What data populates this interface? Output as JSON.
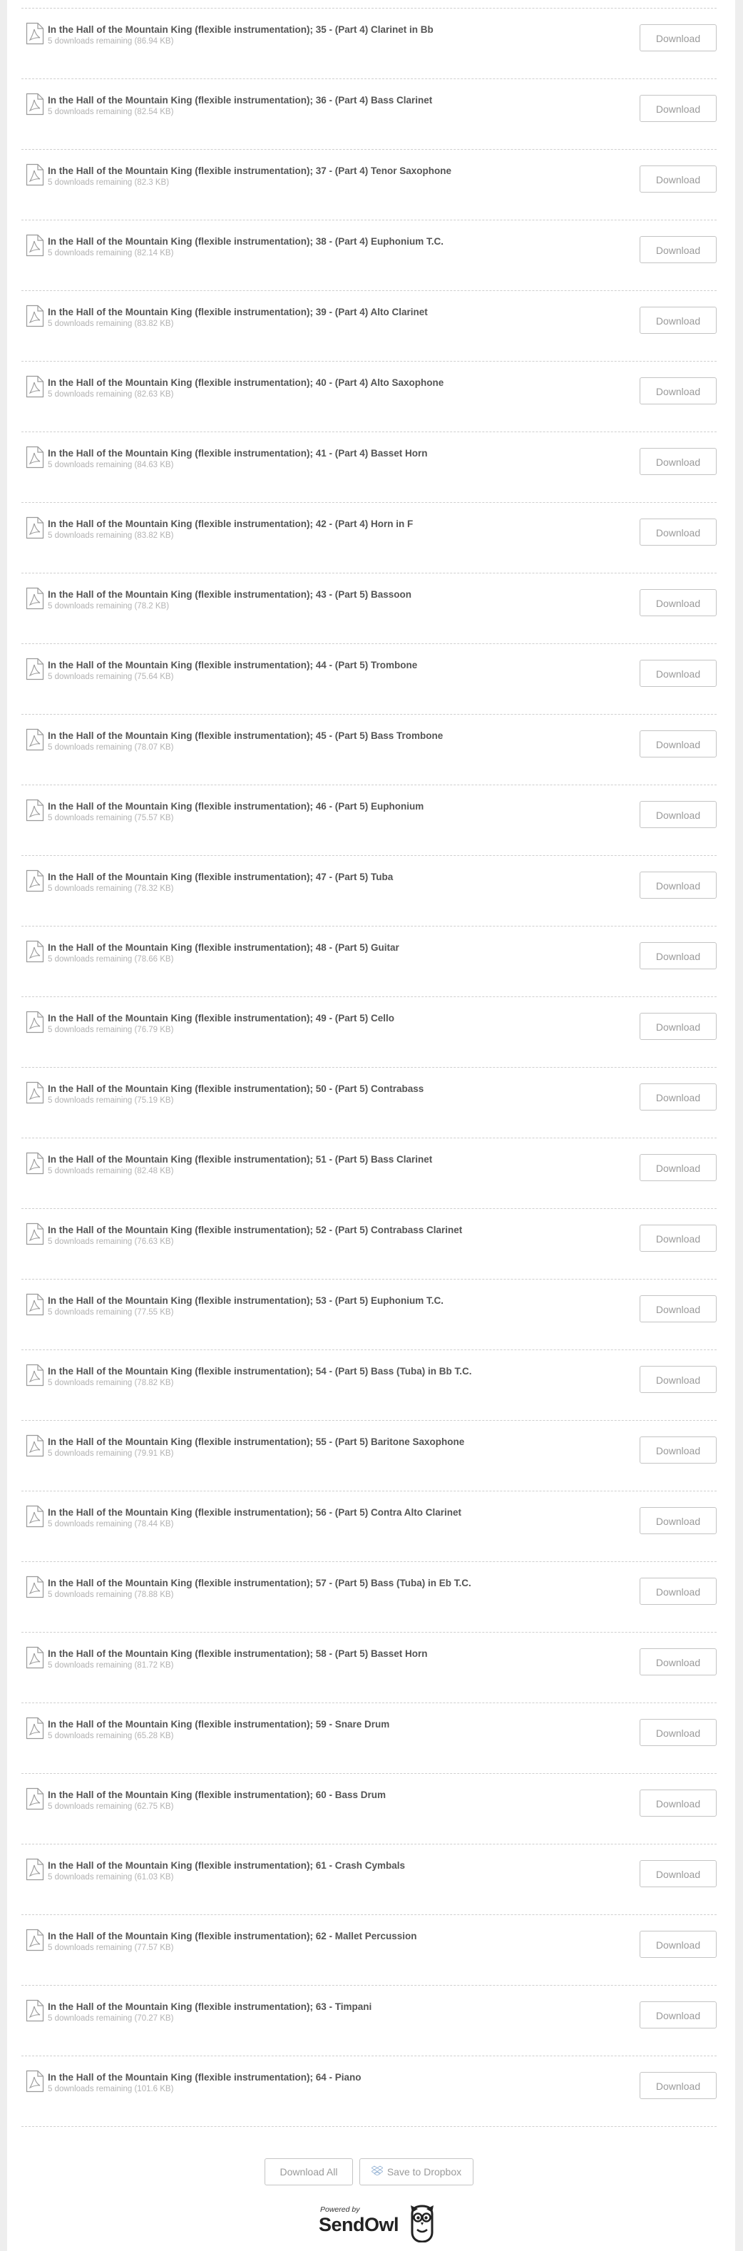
{
  "rows": [
    {
      "title": "In the Hall of the Mountain King (flexible instrumentation); 35 - (Part 4) Clarinet in Bb",
      "meta": "5 downloads remaining (86.94 KB)",
      "button": "Download"
    },
    {
      "title": "In the Hall of the Mountain King (flexible instrumentation); 36 - (Part 4) Bass Clarinet",
      "meta": "5 downloads remaining (82.54 KB)",
      "button": "Download"
    },
    {
      "title": "In the Hall of the Mountain King (flexible instrumentation); 37 - (Part 4) Tenor Saxophone",
      "meta": "5 downloads remaining (82.3 KB)",
      "button": "Download"
    },
    {
      "title": "In the Hall of the Mountain King (flexible instrumentation); 38 - (Part 4) Euphonium T.C.",
      "meta": "5 downloads remaining (82.14 KB)",
      "button": "Download"
    },
    {
      "title": "In the Hall of the Mountain King (flexible instrumentation); 39 - (Part 4) Alto Clarinet",
      "meta": "5 downloads remaining (83.82 KB)",
      "button": "Download"
    },
    {
      "title": "In the Hall of the Mountain King (flexible instrumentation); 40 - (Part 4) Alto Saxophone",
      "meta": "5 downloads remaining (82.63 KB)",
      "button": "Download"
    },
    {
      "title": "In the Hall of the Mountain King (flexible instrumentation); 41 - (Part 4) Basset Horn",
      "meta": "5 downloads remaining (84.63 KB)",
      "button": "Download"
    },
    {
      "title": "In the Hall of the Mountain King (flexible instrumentation); 42 - (Part 4) Horn in F",
      "meta": "5 downloads remaining (83.82 KB)",
      "button": "Download"
    },
    {
      "title": "In the Hall of the Mountain King (flexible instrumentation); 43 - (Part 5) Bassoon",
      "meta": "5 downloads remaining (78.2 KB)",
      "button": "Download"
    },
    {
      "title": "In the Hall of the Mountain King (flexible instrumentation); 44 - (Part 5) Trombone",
      "meta": "5 downloads remaining (75.64 KB)",
      "button": "Download"
    },
    {
      "title": "In the Hall of the Mountain King (flexible instrumentation); 45 - (Part 5) Bass Trombone",
      "meta": "5 downloads remaining (78.07 KB)",
      "button": "Download"
    },
    {
      "title": "In the Hall of the Mountain King (flexible instrumentation); 46 - (Part 5) Euphonium",
      "meta": "5 downloads remaining (75.57 KB)",
      "button": "Download"
    },
    {
      "title": "In the Hall of the Mountain King (flexible instrumentation); 47 - (Part 5) Tuba",
      "meta": "5 downloads remaining (78.32 KB)",
      "button": "Download"
    },
    {
      "title": "In the Hall of the Mountain King (flexible instrumentation); 48 - (Part 5) Guitar",
      "meta": "5 downloads remaining (78.66 KB)",
      "button": "Download"
    },
    {
      "title": "In the Hall of the Mountain King (flexible instrumentation); 49 - (Part 5) Cello",
      "meta": "5 downloads remaining (76.79 KB)",
      "button": "Download"
    },
    {
      "title": "In the Hall of the Mountain King (flexible instrumentation); 50 - (Part 5) Contrabass",
      "meta": "5 downloads remaining (75.19 KB)",
      "button": "Download"
    },
    {
      "title": "In the Hall of the Mountain King (flexible instrumentation); 51 - (Part 5) Bass Clarinet",
      "meta": "5 downloads remaining (82.48 KB)",
      "button": "Download"
    },
    {
      "title": "In the Hall of the Mountain King (flexible instrumentation); 52 - (Part 5) Contrabass Clarinet",
      "meta": "5 downloads remaining (76.63 KB)",
      "button": "Download"
    },
    {
      "title": "In the Hall of the Mountain King (flexible instrumentation); 53 - (Part 5) Euphonium T.C.",
      "meta": "5 downloads remaining (77.55 KB)",
      "button": "Download"
    },
    {
      "title": "In the Hall of the Mountain King (flexible instrumentation); 54 - (Part 5) Bass (Tuba) in Bb T.C.",
      "meta": "5 downloads remaining (78.82 KB)",
      "button": "Download"
    },
    {
      "title": "In the Hall of the Mountain King (flexible instrumentation); 55 - (Part 5) Baritone Saxophone",
      "meta": "5 downloads remaining (79.91 KB)",
      "button": "Download"
    },
    {
      "title": "In the Hall of the Mountain King (flexible instrumentation); 56 - (Part 5) Contra Alto Clarinet",
      "meta": "5 downloads remaining (78.44 KB)",
      "button": "Download"
    },
    {
      "title": "In the Hall of the Mountain King (flexible instrumentation); 57 - (Part 5) Bass (Tuba) in Eb T.C.",
      "meta": "5 downloads remaining (78.88 KB)",
      "button": "Download"
    },
    {
      "title": "In the Hall of the Mountain King (flexible instrumentation); 58 - (Part 5) Basset Horn",
      "meta": "5 downloads remaining (81.72 KB)",
      "button": "Download"
    },
    {
      "title": "In the Hall of the Mountain King (flexible instrumentation); 59 - Snare Drum",
      "meta": "5 downloads remaining (65.28 KB)",
      "button": "Download"
    },
    {
      "title": "In the Hall of the Mountain King (flexible instrumentation); 60 - Bass Drum",
      "meta": "5 downloads remaining (62.75 KB)",
      "button": "Download"
    },
    {
      "title": "In the Hall of the Mountain King (flexible instrumentation); 61 - Crash Cymbals",
      "meta": "5 downloads remaining (61.03 KB)",
      "button": "Download"
    },
    {
      "title": "In the Hall of the Mountain King (flexible instrumentation); 62 - Mallet Percussion",
      "meta": "5 downloads remaining (77.57 KB)",
      "button": "Download"
    },
    {
      "title": "In the Hall of the Mountain King (flexible instrumentation); 63 - Timpani",
      "meta": "5 downloads remaining (70.27 KB)",
      "button": "Download"
    },
    {
      "title": "In the Hall of the Mountain King (flexible instrumentation); 64 - Piano",
      "meta": "5 downloads remaining (101.6 KB)",
      "button": "Download"
    }
  ],
  "footer": {
    "download_all": "Download All",
    "save_dropbox": "Save to Dropbox",
    "powered_by": "Powered by",
    "brand": "SendOwl"
  },
  "icons": {
    "file": "pdf-file-icon",
    "dropbox": "dropbox-icon",
    "owl": "owl-logo-icon"
  },
  "colors": {
    "background": "#eeeeee",
    "panel": "#ffffff",
    "title_text": "#555555",
    "meta_text": "#b3b3b3",
    "button_border": "#c4c4c4",
    "button_text": "#9a9a9a"
  }
}
